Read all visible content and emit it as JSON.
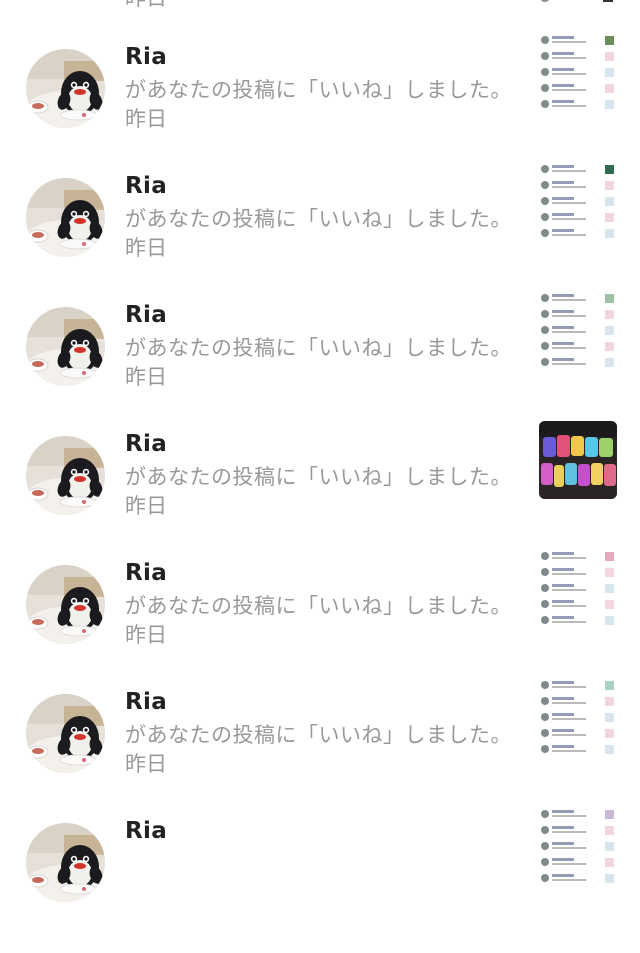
{
  "notifications": [
    {
      "name": "Ria",
      "message": "があなたの投稿に「いいね」しました。",
      "time": "昨日",
      "thumb": "screenshot",
      "thumb_accent": "#6a8f5a"
    },
    {
      "name": "Ria",
      "message": "があなたの投稿に「いいね」しました。",
      "time": "昨日",
      "thumb": "screenshot",
      "thumb_accent": "#2e6b4f"
    },
    {
      "name": "Ria",
      "message": "があなたの投稿に「いいね」しました。",
      "time": "昨日",
      "thumb": "screenshot",
      "thumb_accent": "#9fc2a5"
    },
    {
      "name": "Ria",
      "message": "があなたの投稿に「いいね」しました。",
      "time": "昨日",
      "thumb": "photo",
      "thumb_accent": "#c64fd0"
    },
    {
      "name": "Ria",
      "message": "があなたの投稿に「いいね」しました。",
      "time": "昨日",
      "thumb": "screenshot",
      "thumb_accent": "#e7a9bf"
    },
    {
      "name": "Ria",
      "message": "があなたの投稿に「いいね」しました。",
      "time": "昨日",
      "thumb": "screenshot",
      "thumb_accent": "#a7d4c2"
    },
    {
      "name": "Ria",
      "message": "",
      "time": "",
      "thumb": "screenshot",
      "thumb_accent": "#c9b7d6"
    }
  ],
  "top_partial": {
    "time": "昨日"
  }
}
